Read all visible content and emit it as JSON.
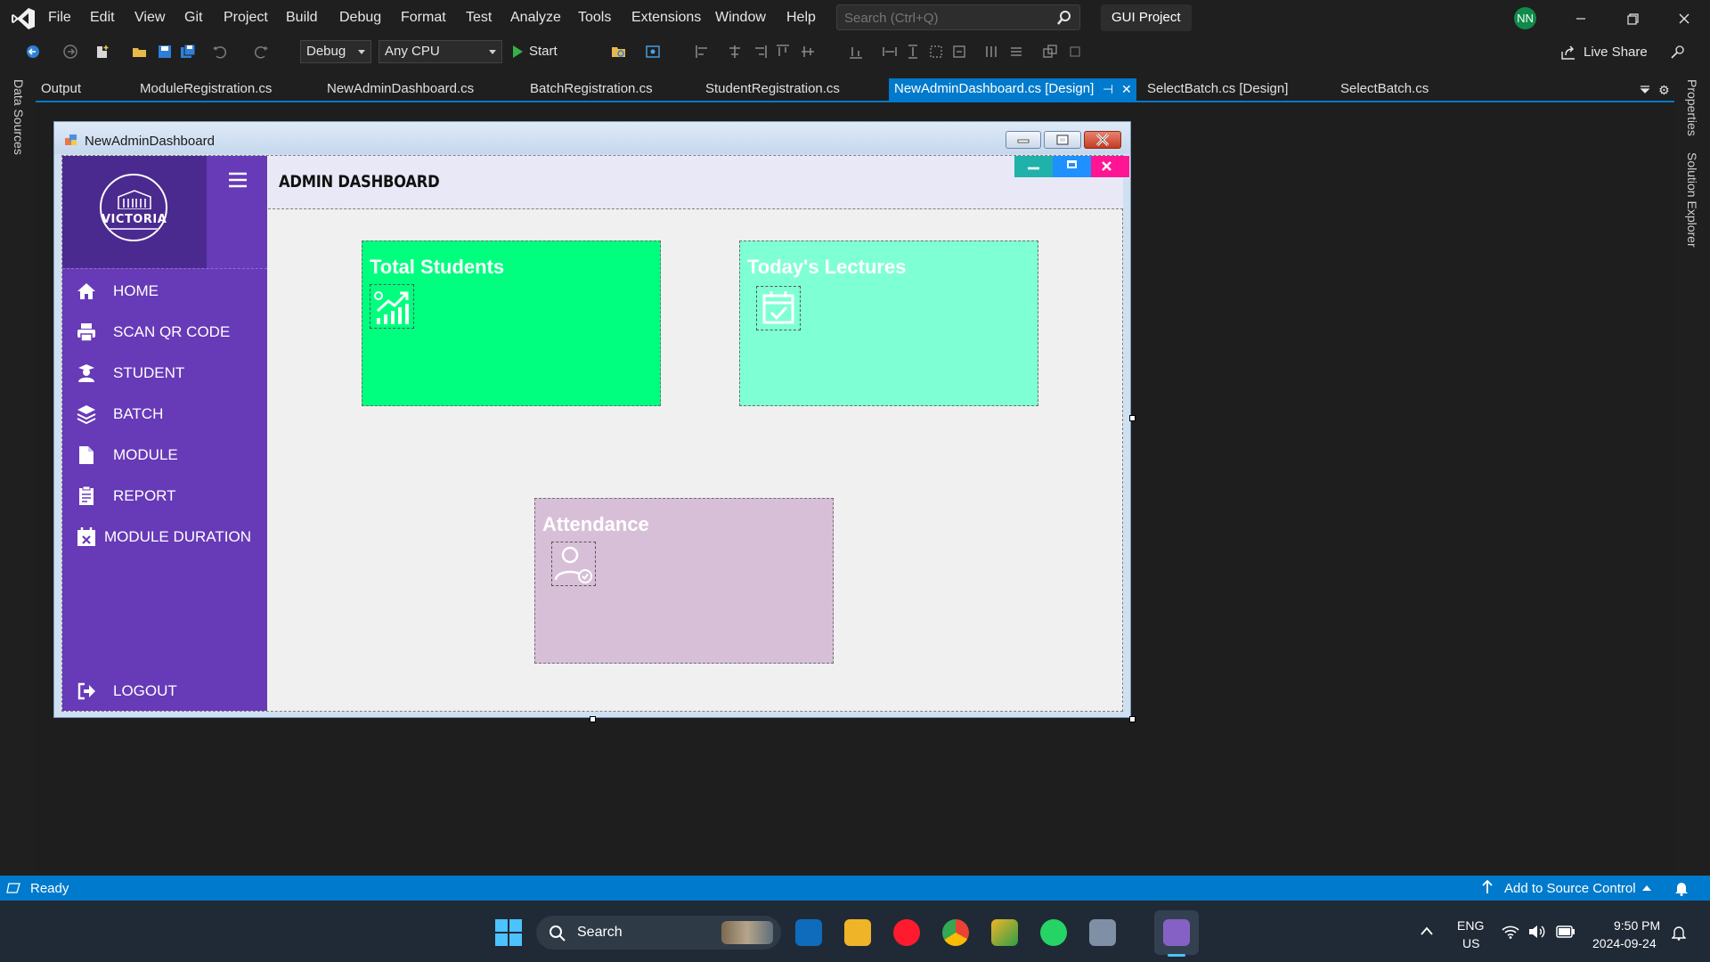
{
  "menubar": {
    "items": [
      "File",
      "Edit",
      "View",
      "Git",
      "Project",
      "Build",
      "Debug",
      "Format",
      "Test",
      "Analyze",
      "Tools",
      "Extensions",
      "Window",
      "Help"
    ],
    "search_placeholder": "Search (Ctrl+Q)",
    "solution_name": "GUI Project",
    "user_initials": "NN"
  },
  "toolbar": {
    "configuration": "Debug",
    "platform": "Any CPU",
    "start_label": "Start",
    "live_share_label": "Live Share"
  },
  "side_panels": {
    "left": "Data Sources",
    "right_properties": "Properties",
    "right_solution_explorer": "Solution Explorer"
  },
  "tabs": [
    {
      "label": "Output"
    },
    {
      "label": "ModuleRegistration.cs"
    },
    {
      "label": "NewAdminDashboard.cs"
    },
    {
      "label": "BatchRegistration.cs"
    },
    {
      "label": "StudentRegistration.cs"
    },
    {
      "label": "NewAdminDashboard.cs [Design]"
    },
    {
      "label": "SelectBatch.cs [Design]"
    },
    {
      "label": "SelectBatch.cs"
    }
  ],
  "form": {
    "window_title": "NewAdminDashboard",
    "logo_text": "VICTORIA",
    "page_title": "ADMIN DASHBOARD",
    "header_buttons": {
      "minimize": "–",
      "maximize": "▬",
      "close": "X"
    },
    "nav_items": [
      {
        "label": "HOME",
        "icon": "home-icon"
      },
      {
        "label": "SCAN QR CODE",
        "icon": "printer-icon"
      },
      {
        "label": "STUDENT",
        "icon": "student-icon"
      },
      {
        "label": "BATCH",
        "icon": "layers-icon"
      },
      {
        "label": "MODULE",
        "icon": "document-icon"
      },
      {
        "label": "REPORT",
        "icon": "report-icon"
      },
      {
        "label": "MODULE DURATION",
        "icon": "calendar-x-icon"
      }
    ],
    "logout_label": "LOGOUT",
    "cards": [
      {
        "title": "Total Students",
        "icon": "chart-growth-icon",
        "color": "#00ff7f"
      },
      {
        "title": "Today's Lectures",
        "icon": "calendar-check-icon",
        "color": "#7fffd4"
      },
      {
        "title": "Attendance",
        "icon": "user-check-icon",
        "color": "#d8bfd8"
      }
    ]
  },
  "statusbar": {
    "status": "Ready",
    "source_control": "Add to Source Control"
  },
  "taskbar": {
    "search_label": "Search",
    "language_line1": "ENG",
    "language_line2": "US",
    "time": "9:50 PM",
    "date": "2024-09-24"
  },
  "colors": {
    "accent": "#007acc",
    "sidebar": "#673ab7",
    "logo_panel": "#4b2a8f"
  }
}
